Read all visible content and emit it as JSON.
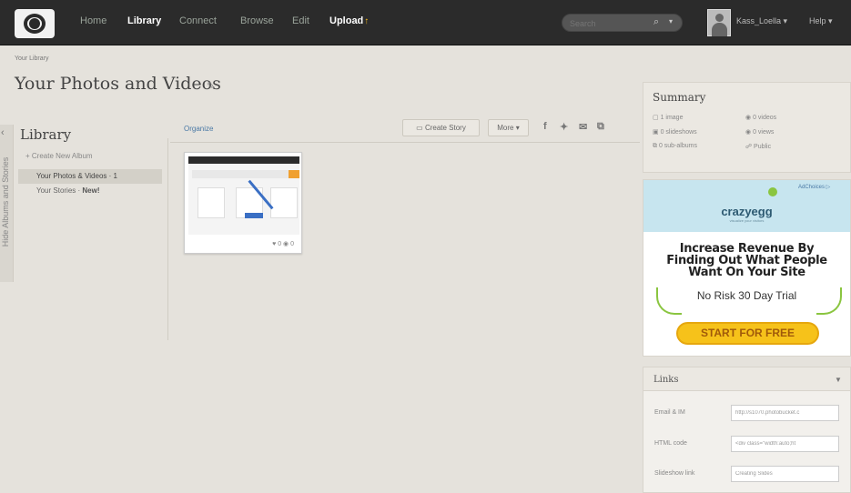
{
  "nav": {
    "home": "Home",
    "library": "Library",
    "connect": "Connect",
    "browse": "Browse",
    "edit": "Edit",
    "upload": "Upload",
    "upload_arrow": "↑"
  },
  "search": {
    "placeholder": "Search"
  },
  "user_menu": "Kass_Loella ▾",
  "help_menu": "Help ▾",
  "breadcrumb": "Your Library",
  "page_title": "Your Photos and Videos",
  "sidebar": {
    "hide_label": "Hide Albums and Stories",
    "title": "Library",
    "create_album": "+ Create New Album",
    "items": [
      {
        "label": "Your Photos & Videos · 1",
        "selected": true
      },
      {
        "label": "Your Stories · ",
        "badge": "New!",
        "selected": false
      }
    ]
  },
  "toolbar": {
    "organize": "Organize",
    "create_story": "Create Story",
    "more": "More ▾"
  },
  "thumbnail": {
    "stats": "♥ 0 ◉ 0"
  },
  "summary": {
    "title": "Summary",
    "images": "1 image",
    "slideshows": "0 slideshows",
    "sub_albums": "0 sub-albums",
    "videos": "0 videos",
    "views": "0 views",
    "privacy": "Public"
  },
  "ad": {
    "adchoices": "AdChoices ▷",
    "brand": "crazyegg",
    "brand_sub": "visualize your visitors",
    "headline_1": "Increase Revenue By",
    "headline_2": "Finding Out What People",
    "headline_3": "Want On Your Site",
    "sub": "No Risk 30 Day Trial",
    "cta": "START FOR FREE"
  },
  "links": {
    "title": "Links",
    "email_label": "Email & IM",
    "email_value": "http://s1070.photobucket.c",
    "html_label": "HTML code",
    "html_value": "<div class=\"width:auto;ht",
    "slideshow_label": "Slideshow link",
    "slideshow_value": "Creating Slides"
  },
  "colors": {
    "topbar": "#2b2b2b",
    "background": "#e5e2dc",
    "link": "#4a79a5",
    "cta": "#f6c21a",
    "brand_green": "#8ac540"
  }
}
